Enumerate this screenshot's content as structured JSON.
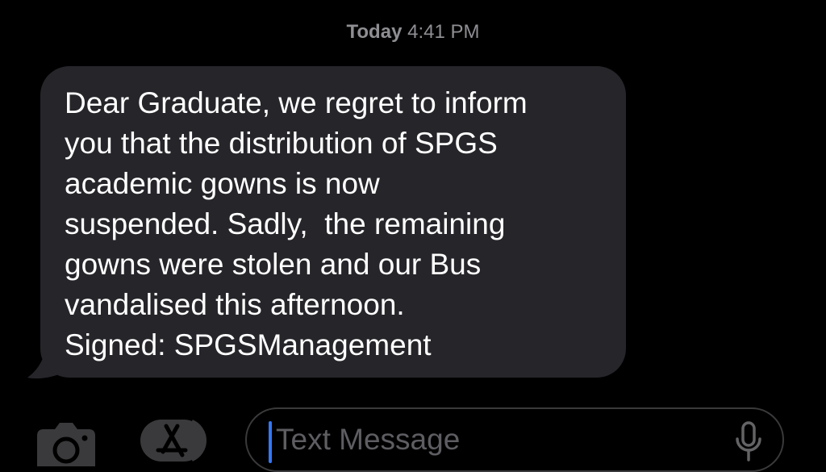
{
  "header": {
    "timestamp_day": "Today",
    "timestamp_time": "4:41 PM"
  },
  "message": {
    "lines": [
      "Dear Graduate, we regret to inform",
      "you that the distribution of SPGS",
      "academic gowns is now",
      "suspended. Sadly,  the remaining",
      "gowns were stolen and our Bus",
      "vandalised this afternoon.",
      "Signed: SPGSManagement"
    ]
  },
  "input_bar": {
    "placeholder": "Text Message",
    "icons": [
      "camera-icon",
      "app-store-icon",
      "microphone-icon"
    ]
  },
  "colors": {
    "background": "#000000",
    "bubble": "#26252a",
    "text": "#ffffff",
    "timestamp": "#8e8e93",
    "cursor": "#3478f6",
    "placeholder": "#5d5d62"
  }
}
